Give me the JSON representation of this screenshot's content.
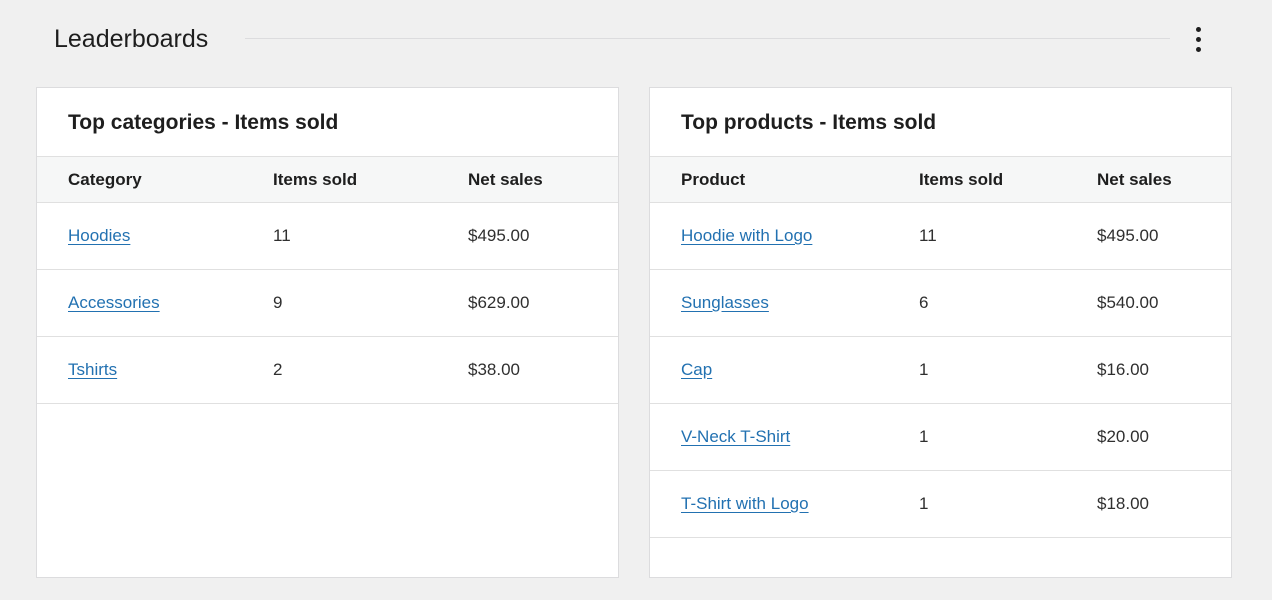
{
  "header": {
    "title": "Leaderboards",
    "menu_icon": "more-vertical-icon"
  },
  "categories": {
    "title": "Top categories - Items sold",
    "columns": [
      "Category",
      "Items sold",
      "Net sales"
    ],
    "rows": [
      {
        "name": "Hoodies",
        "items_sold": "11",
        "net_sales": "$495.00"
      },
      {
        "name": "Accessories",
        "items_sold": "9",
        "net_sales": "$629.00"
      },
      {
        "name": "Tshirts",
        "items_sold": "2",
        "net_sales": "$38.00"
      }
    ]
  },
  "products": {
    "title": "Top products - Items sold",
    "columns": [
      "Product",
      "Items sold",
      "Net sales"
    ],
    "rows": [
      {
        "name": "Hoodie with Logo",
        "items_sold": "11",
        "net_sales": "$495.00"
      },
      {
        "name": "Sunglasses",
        "items_sold": "6",
        "net_sales": "$540.00"
      },
      {
        "name": "Cap",
        "items_sold": "1",
        "net_sales": "$16.00"
      },
      {
        "name": "V-Neck T-Shirt",
        "items_sold": "1",
        "net_sales": "$20.00"
      },
      {
        "name": "T-Shirt with Logo",
        "items_sold": "1",
        "net_sales": "$18.00"
      }
    ]
  },
  "colors": {
    "link": "#2271b1",
    "background": "#f0f0f0",
    "card": "#ffffff",
    "table_header": "#f6f7f7"
  }
}
